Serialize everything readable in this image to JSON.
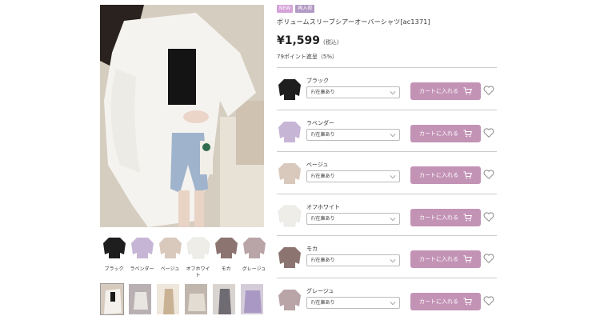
{
  "product": {
    "badges": {
      "new": "NEW",
      "restock": "再入荷"
    },
    "title": "ボリュームスリーブシアーオーバーシャツ[ac1371]",
    "price": "¥1,599",
    "tax_note": "(税込)",
    "points": "79ポイント進呈（5%）"
  },
  "swatches": [
    {
      "label": "ブラック",
      "color": "#1e1e1e"
    },
    {
      "label": "ラベンダー",
      "color": "#c7b5d6"
    },
    {
      "label": "ベージュ",
      "color": "#d9c8bc"
    },
    {
      "label": "オフホワイト",
      "color": "#efede8"
    },
    {
      "label": "モカ",
      "color": "#8c7470"
    },
    {
      "label": "グレージュ",
      "color": "#b9a4a8"
    }
  ],
  "thumbnails": [
    {
      "color": "#d7cabe"
    },
    {
      "color": "#b9b0b3"
    },
    {
      "color": "#c9b293"
    },
    {
      "color": "#c0b6ad"
    },
    {
      "color": "#6f6b72"
    },
    {
      "color": "#a998c4"
    }
  ],
  "variants": [
    {
      "name": "ブラック",
      "select_value": "F/在庫あり",
      "cart_label": "カートに入れる",
      "color": "#1e1e1e"
    },
    {
      "name": "ラベンダー",
      "select_value": "F/在庫あり",
      "cart_label": "カートに入れる",
      "color": "#c7b5d6"
    },
    {
      "name": "ベージュ",
      "select_value": "F/在庫あり",
      "cart_label": "カートに入れる",
      "color": "#d9c8bc"
    },
    {
      "name": "オフホワイト",
      "select_value": "F/在庫あり",
      "cart_label": "カートに入れる",
      "color": "#efede8"
    },
    {
      "name": "モカ",
      "select_value": "F/在庫あり",
      "cart_label": "カートに入れる",
      "color": "#8c7470"
    },
    {
      "name": "グレージュ",
      "select_value": "F/在庫あり",
      "cart_label": "カートに入れる",
      "color": "#b9a4a8"
    }
  ],
  "colors": {
    "cart_button": "#c393b6",
    "badge_new": "#d6a3d9",
    "badge_restock": "#b39ac4"
  },
  "icons": {
    "cart": "cart-icon",
    "favorite": "heart-icon",
    "dropdown": "chevron-down-icon"
  }
}
